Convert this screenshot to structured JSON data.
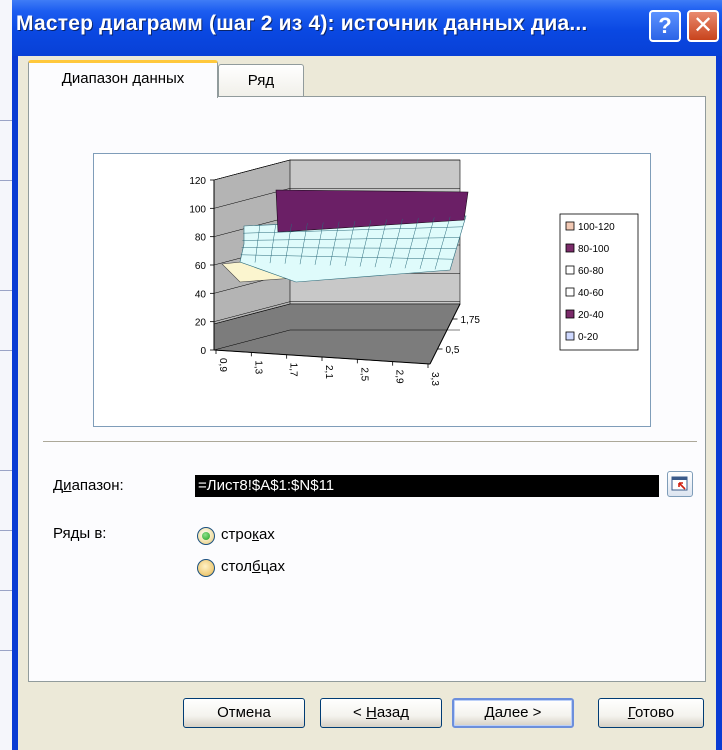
{
  "dialog": {
    "title": "Мастер диаграмм (шаг 2 из 4): источник данных диа...",
    "help_glyph": "?",
    "close_glyph": "✕"
  },
  "tabs": [
    {
      "label": "Диапазон данных",
      "active": true
    },
    {
      "label": "Ряд",
      "active": false
    }
  ],
  "chart_data": {
    "type": "surface",
    "y_ticks": [
      "0",
      "20",
      "40",
      "60",
      "80",
      "100",
      "120"
    ],
    "x_ticks": [
      "0,9",
      "1,3",
      "1,7",
      "2,1",
      "2,5",
      "2,9",
      "3,3"
    ],
    "depth_ticks": [
      "1,75",
      "0,5"
    ],
    "ylim": [
      0,
      120
    ],
    "legend": [
      {
        "label": "100-120",
        "color": "#f2c9b4"
      },
      {
        "label": "80-100",
        "color": "#7b2b6a"
      },
      {
        "label": "60-80",
        "color": "#ffffff"
      },
      {
        "label": "40-60",
        "color": "#ffffff"
      },
      {
        "label": "20-40",
        "color": "#7b2b6a"
      },
      {
        "label": "0-20",
        "color": "#cfd9ff"
      }
    ],
    "legend_position": "right",
    "surface_bands": [
      {
        "band": "80-100",
        "color": "#6b1f66"
      },
      {
        "band": "60-80",
        "color": "#dffbfb"
      },
      {
        "band": "40-60",
        "color": "#fbf5cf"
      }
    ]
  },
  "form": {
    "range_label_pre": "Д",
    "range_label_u": "и",
    "range_label_post": "апазон:",
    "range_value": "=Лист8!$A$1:$N$11",
    "series_in_label": "Ряды в:",
    "rows_pre": "стро",
    "rows_u": "к",
    "rows_post": "ах",
    "rows_checked": true,
    "cols_pre": "стол",
    "cols_u": "б",
    "cols_post": "цах",
    "cols_checked": false
  },
  "buttons": {
    "cancel": "Отмена",
    "back_pre": "< ",
    "back_u": "Н",
    "back_post": "азад",
    "next_u": "Д",
    "next_post": "алее >",
    "finish_u": "Г",
    "finish_post": "отово"
  }
}
